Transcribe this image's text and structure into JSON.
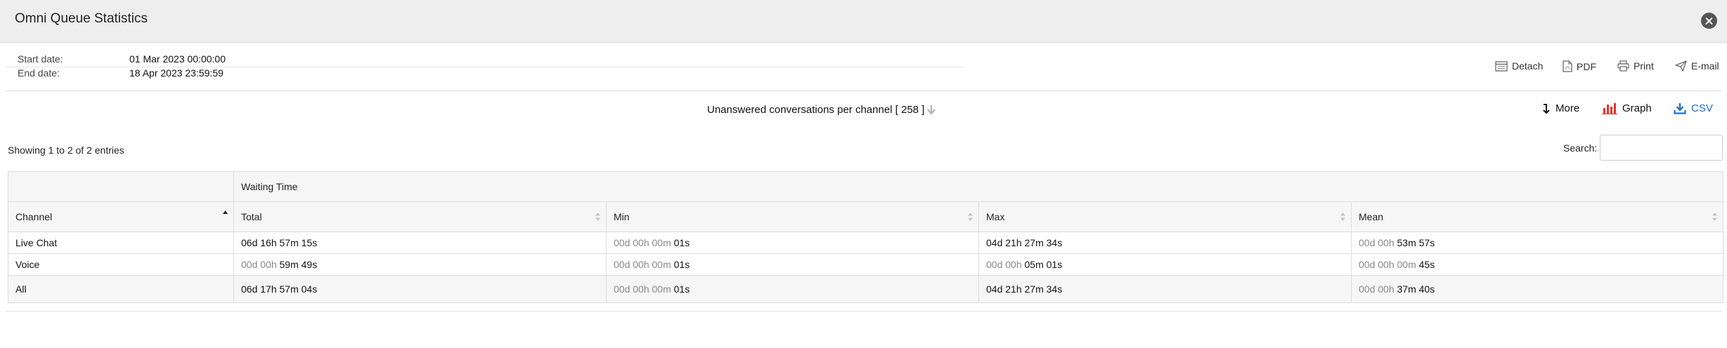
{
  "window": {
    "title": "Omni Queue Statistics"
  },
  "dates": {
    "start_label": "Start date:",
    "start_value": "01 Mar 2023 00:00:00",
    "end_label": "End date:",
    "end_value": "18 Apr 2023 23:59:59"
  },
  "toolbar": {
    "detach": "Detach",
    "pdf": "PDF",
    "print": "Print",
    "email": "E-mail"
  },
  "report": {
    "title": "Unanswered conversations per channel [ 258 ]",
    "more": "More",
    "graph": "Graph",
    "csv": "CSV",
    "graph_color": "#e0362c",
    "csv_color": "#1f6fd6"
  },
  "list": {
    "entries_info": "Showing 1 to 2 of 2 entries",
    "search_label": "Search:",
    "search_value": ""
  },
  "table": {
    "group_header": "Waiting Time",
    "columns": [
      "Channel",
      "Total",
      "Min",
      "Max",
      "Mean"
    ],
    "rows": [
      {
        "channel": "Live Chat",
        "total": {
          "dim": "",
          "main": "06d 16h 57m 15s"
        },
        "min": {
          "dim": "00d 00h 00m ",
          "main": "01s"
        },
        "max": {
          "dim": "",
          "main": "04d 21h 27m 34s"
        },
        "mean": {
          "dim": "00d 00h ",
          "main": "53m 57s"
        }
      },
      {
        "channel": "Voice",
        "total": {
          "dim": "00d 00h ",
          "main": "59m 49s"
        },
        "min": {
          "dim": "00d 00h 00m ",
          "main": "01s"
        },
        "max": {
          "dim": "00d 00h ",
          "main": "05m 01s"
        },
        "mean": {
          "dim": "00d 00h 00m ",
          "main": "45s"
        }
      }
    ],
    "footer": {
      "channel": "All",
      "total": {
        "dim": "",
        "main": "06d 17h 57m 04s"
      },
      "min": {
        "dim": "00d 00h 00m ",
        "main": "01s"
      },
      "max": {
        "dim": "",
        "main": "04d 21h 27m 34s"
      },
      "mean": {
        "dim": "00d 00h ",
        "main": "37m 40s"
      }
    }
  }
}
